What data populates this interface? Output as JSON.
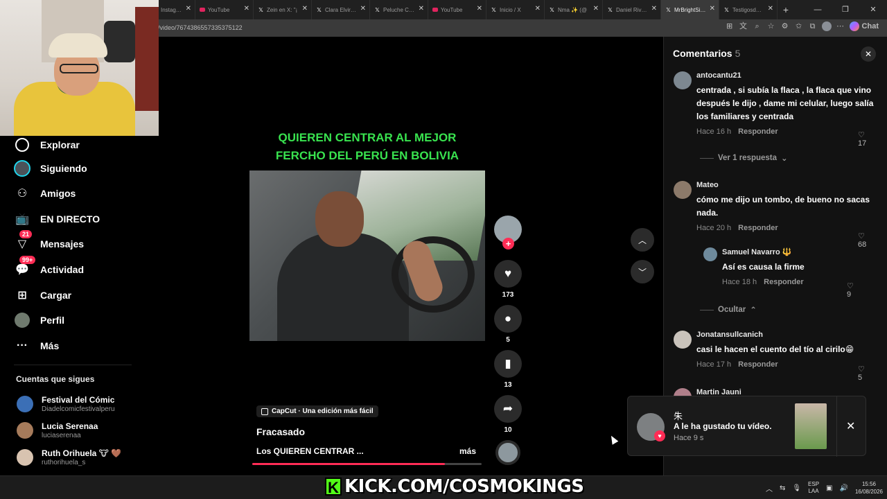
{
  "browser": {
    "tabs": [
      {
        "label": "Instagram",
        "icon": "instagram-icon",
        "fav": ""
      },
      {
        "label": "YouTube",
        "icon": "youtube-icon",
        "fav": "yt"
      },
      {
        "label": "Zein en X: \"¡",
        "icon": "x-logo-icon",
        "fav": "x"
      },
      {
        "label": "Clara Elvira C",
        "icon": "x-logo-icon",
        "fav": "x"
      },
      {
        "label": "Peluche Calid",
        "icon": "x-logo-icon",
        "fav": "x"
      },
      {
        "label": "YouTube",
        "icon": "youtube-icon",
        "fav": "yt"
      },
      {
        "label": "Inicio / X",
        "icon": "x-logo-icon",
        "fav": "x"
      },
      {
        "label": "Nma ✨ (@",
        "icon": "x-logo-icon",
        "fav": "x"
      },
      {
        "label": "Daniel Rivera",
        "icon": "x-logo-icon",
        "fav": "x"
      },
      {
        "label": "MrBrightSide",
        "icon": "x-logo-icon",
        "fav": "x",
        "active": true
      },
      {
        "label": "Testigosdeca",
        "icon": "x-logo-icon",
        "fav": "x"
      }
    ],
    "url": "/video/7674386557335375122",
    "chat_label": "Chat"
  },
  "sidebar": {
    "items": [
      {
        "label": "Explorar",
        "icon": "compass-icon",
        "badge": ""
      },
      {
        "label": "Siguiendo",
        "icon": "following-avatar-icon",
        "badge": ""
      },
      {
        "label": "Amigos",
        "icon": "friends-icon",
        "badge": ""
      },
      {
        "label": "EN DIRECTO",
        "icon": "live-tv-icon",
        "badge": ""
      },
      {
        "label": "Mensajes",
        "icon": "messages-icon",
        "badge": "21"
      },
      {
        "label": "Actividad",
        "icon": "activity-icon",
        "badge": "99+"
      },
      {
        "label": "Cargar",
        "icon": "upload-icon",
        "badge": ""
      },
      {
        "label": "Perfil",
        "icon": "profile-avatar-icon",
        "badge": ""
      },
      {
        "label": "Más",
        "icon": "more-icon",
        "badge": ""
      }
    ],
    "following_title": "Cuentas que sigues",
    "following": [
      {
        "name": "Festival del Cómic",
        "username": "Diadelcomicfestivalperu",
        "color": "#3b6fb6"
      },
      {
        "name": "Lucia Serenaa",
        "username": "luciaserenaa",
        "color": "#a67b5b"
      },
      {
        "name": "Ruth Orihuela 🐮 🤎",
        "username": "ruthorihuela_s",
        "color": "#d8c3b0"
      }
    ]
  },
  "video": {
    "title_line1": "QUIEREN CENTRAR AL MEJOR",
    "title_line2": "FERCHO DEL PERÚ EN BOLIVIA",
    "capcut_label": "CapCut · Una edición más fácil",
    "author": "Fracasado",
    "description": "Los QUIEREN CENTRAR ...",
    "more_label": "más",
    "progress": 0.84,
    "likes": "173",
    "comments": "5",
    "saves": "13",
    "shares": "10"
  },
  "comments_panel": {
    "title": "Comentarios",
    "count": "5",
    "reply_label": "Responder",
    "comments": [
      {
        "user": "antocantu21",
        "text": "centrada , si subía la flaca , la flaca que vino después le dijo , dame mi celular, luego salía los familiares y centrada",
        "time": "Hace 16 h",
        "likes": "17",
        "color": "#7d8891"
      },
      {
        "user": "Mateo",
        "text": "cómo me dijo un tombo, de bueno no sacas nada.",
        "time": "Hace 20 h",
        "likes": "68",
        "color": "#8c7a6a"
      },
      {
        "user": "Samuel Navarro 🔱",
        "text": "Así es causa la firme",
        "time": "Hace 18 h",
        "likes": "9",
        "color": "#6e8a9c"
      },
      {
        "user": "Jonatansullcanich",
        "text": "casi le hacen el cuento del tío al cirilo😁",
        "time": "Hace 17 h",
        "likes": "5",
        "color": "#c9c3bb"
      },
      {
        "user": "Martin Jauni",
        "text": "",
        "time": "",
        "likes": "",
        "color": "#b07f8a"
      }
    ],
    "view_replies": "Ver 1 respuesta",
    "hide_label": "Ocultar"
  },
  "notification": {
    "user": "朱",
    "text": "A le ha gustado tu vídeo.",
    "time": "Hace 9 s"
  },
  "overlay": {
    "kick_text": "KICK.COM/COSMOKINGS"
  },
  "taskbar": {
    "lang_line1": "ESP",
    "lang_line2": "LAA",
    "time": "15:56",
    "date": "16/08/2026"
  }
}
